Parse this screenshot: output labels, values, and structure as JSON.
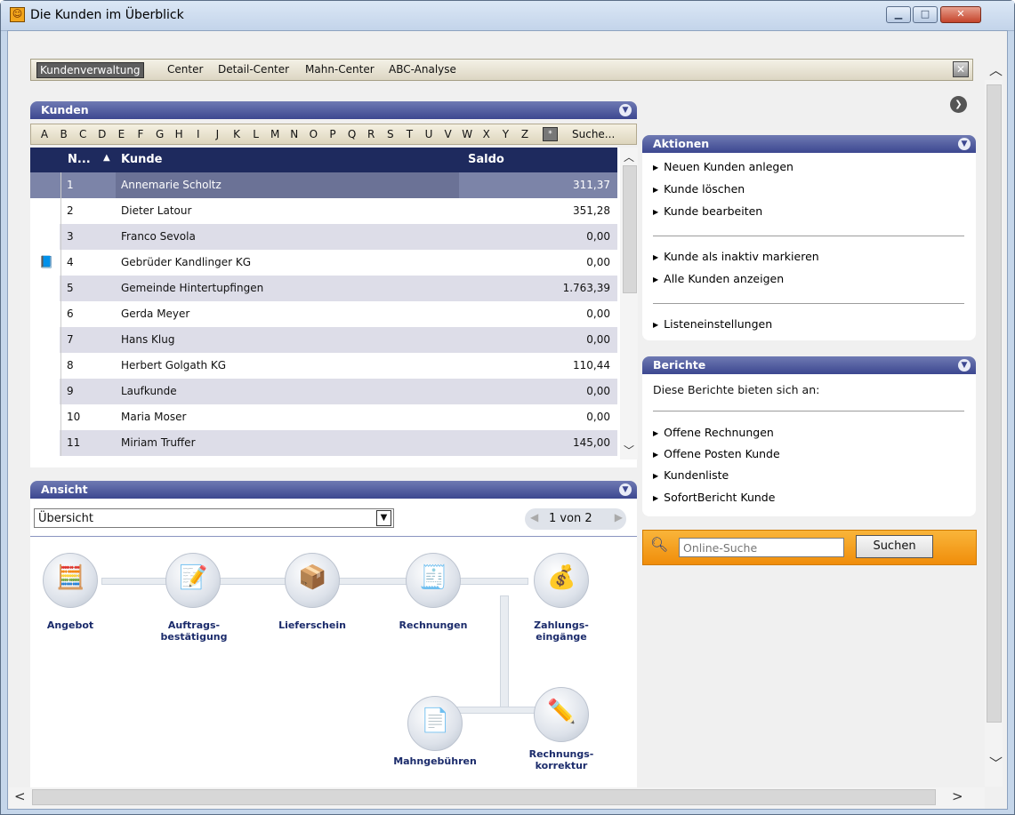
{
  "window": {
    "title": "Die Kunden im Überblick"
  },
  "nav": {
    "tabs": [
      "Kundenverwaltung",
      "Center",
      "Detail-Center",
      "Mahn-Center",
      "ABC-Analyse"
    ]
  },
  "kunden": {
    "title": "Kunden",
    "letters": [
      "A",
      "B",
      "C",
      "D",
      "E",
      "F",
      "G",
      "H",
      "I",
      "J",
      "K",
      "L",
      "M",
      "N",
      "O",
      "P",
      "Q",
      "R",
      "S",
      "T",
      "U",
      "V",
      "W",
      "X",
      "Y",
      "Z"
    ],
    "search_label": "Suche...",
    "columns": {
      "nr": "N...",
      "kunde": "Kunde",
      "saldo": "Saldo"
    },
    "rows": [
      {
        "nr": "1",
        "kunde": "Annemarie Scholtz",
        "saldo": "311,37"
      },
      {
        "nr": "2",
        "kunde": "Dieter Latour",
        "saldo": "351,28"
      },
      {
        "nr": "3",
        "kunde": "Franco Sevola",
        "saldo": "0,00"
      },
      {
        "nr": "4",
        "kunde": "Gebrüder Kandlinger KG",
        "saldo": "0,00"
      },
      {
        "nr": "5",
        "kunde": "Gemeinde Hintertupfingen",
        "saldo": "1.763,39"
      },
      {
        "nr": "6",
        "kunde": "Gerda Meyer",
        "saldo": "0,00"
      },
      {
        "nr": "7",
        "kunde": "Hans Klug",
        "saldo": "0,00"
      },
      {
        "nr": "8",
        "kunde": "Herbert Golgath KG",
        "saldo": "110,44"
      },
      {
        "nr": "9",
        "kunde": "Laufkunde",
        "saldo": "0,00"
      },
      {
        "nr": "10",
        "kunde": "Maria Moser",
        "saldo": "0,00"
      },
      {
        "nr": "11",
        "kunde": "Miriam Truffer",
        "saldo": "145,00"
      }
    ]
  },
  "aktionen": {
    "title": "Aktionen",
    "items": [
      "Neuen Kunden anlegen",
      "Kunde löschen",
      "Kunde bearbeiten",
      "Kunde als inaktiv markieren",
      "Alle Kunden anzeigen",
      "Listeneinstellungen"
    ]
  },
  "berichte": {
    "title": "Berichte",
    "intro": "Diese Berichte bieten sich an:",
    "items": [
      "Offene Rechnungen",
      "Offene Posten Kunde",
      "Kundenliste",
      "SofortBericht Kunde"
    ]
  },
  "search": {
    "placeholder": "Online-Suche",
    "button": "Suchen"
  },
  "ansicht": {
    "title": "Ansicht",
    "selected": "Übersicht",
    "pager": "1 von 2",
    "steps": [
      "Angebot",
      "Auftrags-\nbestätigung",
      "Lieferschein",
      "Rechnungen",
      "Zahlungs-\neingänge",
      "Mahngebühren",
      "Rechnungs-\nkorrektur"
    ]
  },
  "colors": {
    "header": "#1e2a5e",
    "panel": "#4a55a0",
    "selected_row": "#7c84a8",
    "alt_row": "#dddde8",
    "search_bar": "#f6a21b"
  }
}
